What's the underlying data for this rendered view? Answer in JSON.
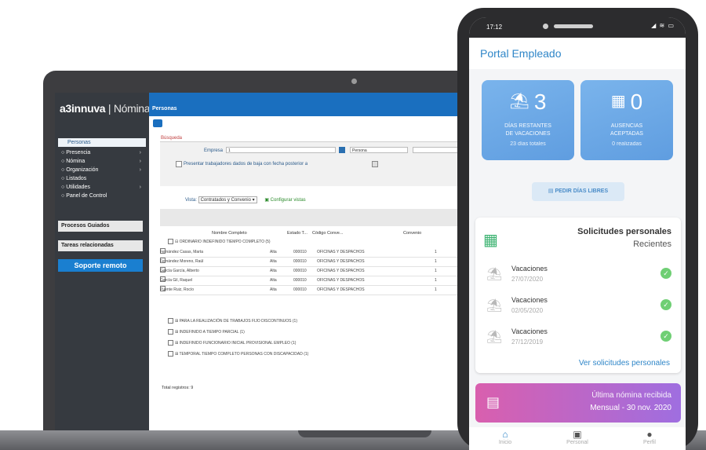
{
  "laptop": {
    "app_name": "a3innuva",
    "app_module": "Nómina",
    "page_title": "Personas",
    "sidebar": {
      "active_item": "Personas",
      "items": [
        {
          "label": "Presencia",
          "arrow": "›"
        },
        {
          "label": "Nómina",
          "arrow": "›"
        },
        {
          "label": "Organización",
          "arrow": "›"
        },
        {
          "label": "Listados",
          "arrow": ""
        },
        {
          "label": "Utilidades",
          "arrow": "›"
        },
        {
          "label": "Panel de Control",
          "arrow": ""
        }
      ],
      "procesos": "Procesos Guiados",
      "tareas": "Tareas relacionadas",
      "support": "Soporte remoto"
    },
    "filters": {
      "section": "Búsqueda",
      "empresa_label": "Empresa",
      "empresa_value": "1",
      "persona_value": "Persona",
      "checkbox_label": "Presentar trabajadores dados de baja con fecha posterior a"
    },
    "vista": {
      "label": "Vista",
      "value": "Contratados y Convenio",
      "config": "Configurar vistas"
    },
    "table": {
      "headers": [
        "Nombre Completo",
        "Estado T...",
        "Código Conve...",
        "Convenio"
      ],
      "group_title": "ORDINARIO INDEFINIDO TIEMPO COMPLETO (5)",
      "rows": [
        [
          "Fernández Casas, Marta",
          "Alta",
          "000010",
          "OFICINAS Y DESPACHOS",
          "1"
        ],
        [
          "Fernández Moreno, Raúl",
          "Alta",
          "000010",
          "OFICINAS Y DESPACHOS",
          "1"
        ],
        [
          "García García, Alberto",
          "Alta",
          "000010",
          "OFICINAS Y DESPACHOS",
          "1"
        ],
        [
          "García Gil, Raquel",
          "Alta",
          "000010",
          "OFICINAS Y DESPACHOS",
          "1"
        ],
        [
          "Puente Ruiz, Rocío",
          "Alta",
          "000010",
          "OFICINAS Y DESPACHOS",
          "1"
        ]
      ],
      "groups": [
        "PARA LA REALIZACIÓN DE TRABAJOS FIJO DISCONTINUOS (1)",
        "INDEFINIDO A TIEMPO PARCIAL (1)",
        "INDEFINIDO FUNCIONARIO INICIAL PROVISIONAL EMPLEO (1)",
        "TEMPORAL TIEMPO COMPLETO PERSONAS CON DISCAPACIDAD (1)"
      ],
      "total": "Total registros: 9"
    }
  },
  "phone": {
    "time": "17:12",
    "status_icons": "◢ ≋ ▭",
    "app_title": "Portal Empleado",
    "cards": [
      {
        "icon": "⛱",
        "value": "3",
        "label_1": "DÍAS RESTANTES",
        "label_2": "DE VACACIONES",
        "sub": "23 días totales"
      },
      {
        "icon": "▦",
        "value": "0",
        "label_1": "AUSENCIAS",
        "label_2": "ACEPTADAS",
        "sub": "0 realizadas"
      }
    ],
    "pedir_button": "PEDIR DÍAS LIBRES",
    "requests": {
      "title": "Solicitudes personales",
      "subtitle": "Recientes",
      "items": [
        {
          "type": "Vacaciones",
          "date": "27/07/2020"
        },
        {
          "type": "Vacaciones",
          "date": "02/05/2020"
        },
        {
          "type": "Vacaciones",
          "date": "27/12/2019"
        }
      ],
      "link": "Ver solicitudes personales"
    },
    "nomina": {
      "title": "Última nómina recibida",
      "subtitle": "Mensual - 30 nov. 2020"
    },
    "tabs": [
      {
        "label": "Inicio",
        "icon": "home-icon"
      },
      {
        "label": "Personal",
        "icon": "briefcase-icon"
      },
      {
        "label": "Perfil",
        "icon": "user-icon"
      }
    ],
    "colors": {
      "accent": "#2f86c8",
      "card_blue": "#6aa7e6",
      "ok_green": "#6fcf74",
      "nomina_gradient_start": "#d95fae",
      "nomina_gradient_end": "#9f6ee0"
    }
  }
}
